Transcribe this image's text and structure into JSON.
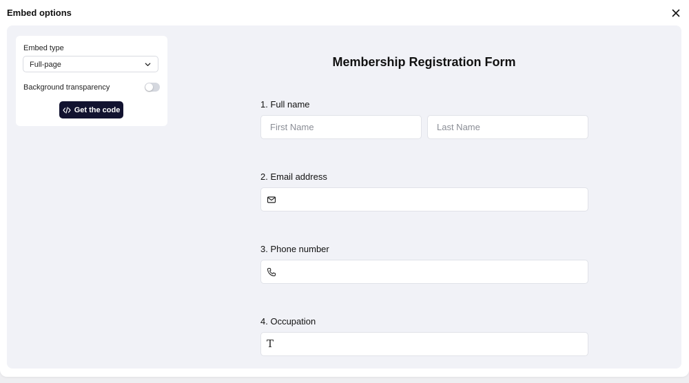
{
  "modal": {
    "title": "Embed options"
  },
  "panel": {
    "embed_type_label": "Embed type",
    "embed_type_value": "Full-page",
    "background_transparency_label": "Background transparency",
    "background_transparency_on": false,
    "get_code_label": "Get the code"
  },
  "form": {
    "title": "Membership Registration Form",
    "questions": [
      {
        "label": "1.  Full name",
        "first_placeholder": "First Name",
        "last_placeholder": "Last Name"
      },
      {
        "label": "2. Email address",
        "icon": "mail-icon"
      },
      {
        "label": "3. Phone number",
        "icon": "phone-icon"
      },
      {
        "label": "4. Occupation",
        "icon": "text-type-icon",
        "icon_glyph": "T"
      }
    ]
  },
  "colors": {
    "accent_button": "#121330",
    "canvas_bg": "#f1f2f7"
  }
}
